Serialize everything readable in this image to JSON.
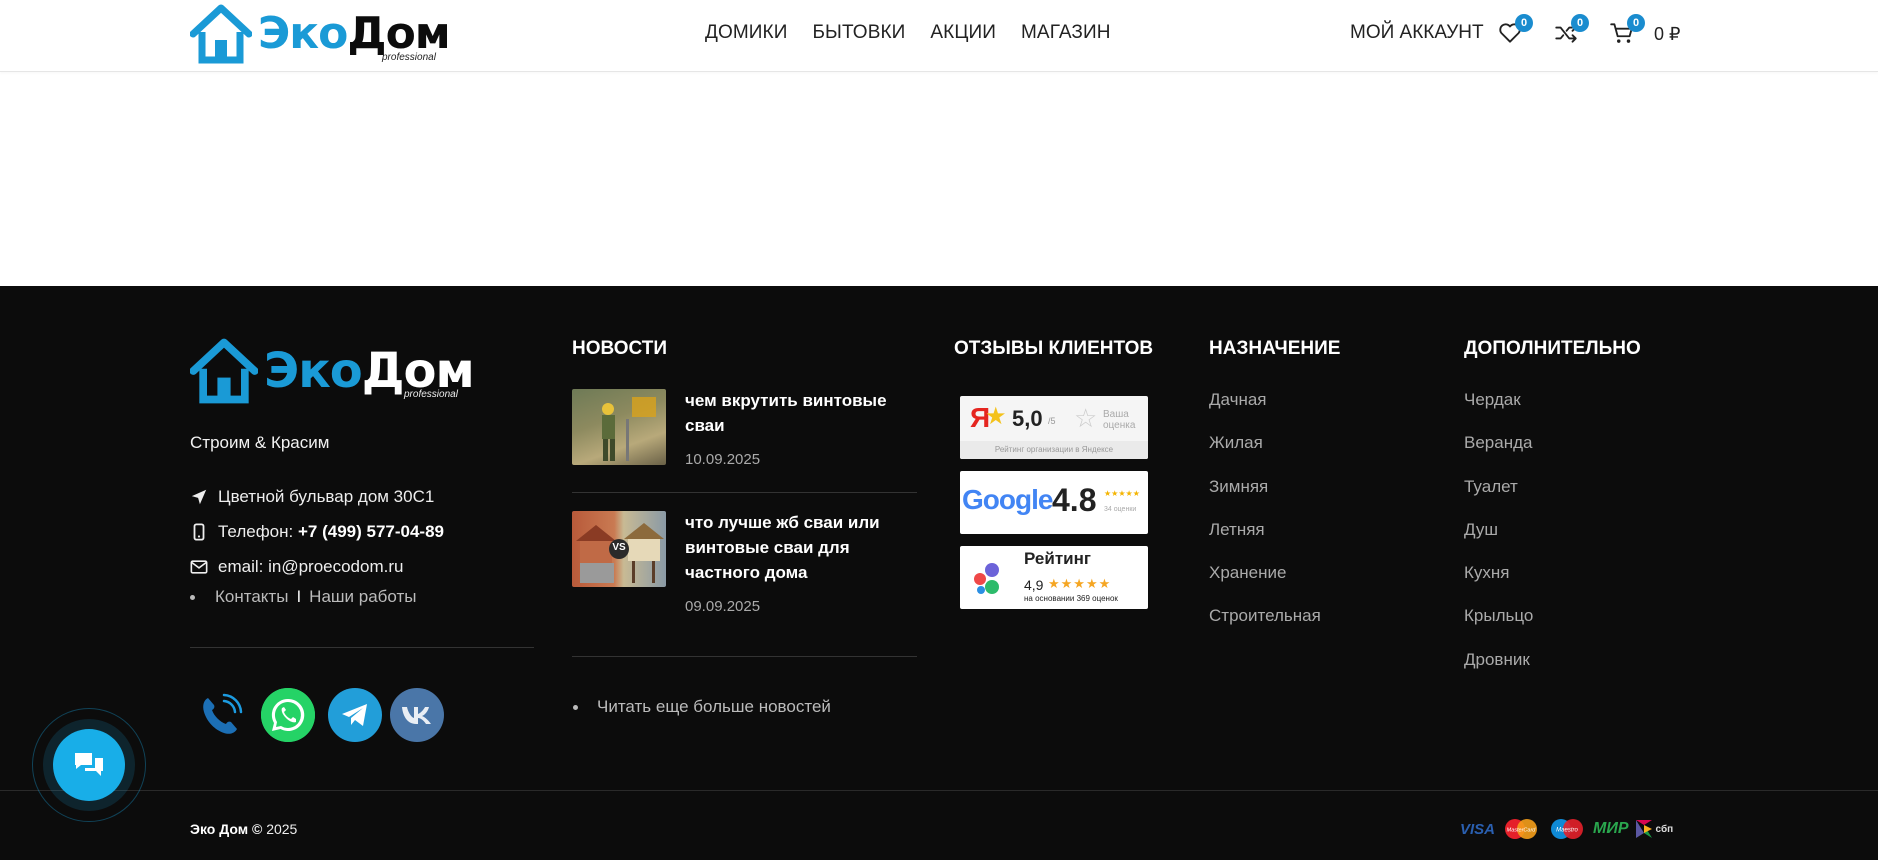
{
  "header": {
    "logo": {
      "part1": "Эко",
      "part2": "Дом",
      "sub": "professional"
    },
    "nav": [
      "ДОМИКИ",
      "БЫТОВКИ",
      "АКЦИИ",
      "МАГАЗИН"
    ],
    "account_label": "МОЙ АККАУНТ",
    "wishlist_count": "0",
    "compare_count": "0",
    "cart_count": "0",
    "cart_total": "0 ₽"
  },
  "footer": {
    "logo": {
      "part1": "Эко",
      "part2": "Дом",
      "sub": "professional"
    },
    "slogan": "Строим & Красим",
    "address": "Цветной бульвар дом 30С1",
    "phone_label": "Телефон:",
    "phone": "+7 (499) 577-04-89",
    "email_label": "email:",
    "email": "in@proecodom.ru",
    "link_contacts": "Контакты",
    "link_separator": "I",
    "link_works": "Наши работы",
    "news": {
      "title": "НОВОСТИ",
      "items": [
        {
          "title": "чем вкрутить винтовые сваи",
          "date": "10.09.2025"
        },
        {
          "title": "что лучше жб сваи или винтовые сваи для частного дома",
          "date": "09.09.2025",
          "thumb_badge": "VS"
        }
      ],
      "more": "Читать еще больше новостей"
    },
    "reviews": {
      "title": "ОТЗЫВЫ КЛИЕНТОВ",
      "yandex": {
        "letter": "Я",
        "score": "5,0",
        "of": "/5",
        "your": "Ваша",
        "rating": "оценка",
        "caption": "Рейтинг организации в Яндексе"
      },
      "google": {
        "brand": "Google",
        "score": "4.8",
        "stars": "★★★★★",
        "caption": "34 оценки"
      },
      "twogis": {
        "title": "Рейтинг",
        "score": "4,9",
        "stars": "★★★★★",
        "caption": "на основании 369 оценок"
      }
    },
    "purpose": {
      "title": "НАЗНАЧЕНИЕ",
      "items": [
        "Дачная",
        "Жилая",
        "Зимняя",
        "Летняя",
        "Хранение",
        "Строительная"
      ]
    },
    "extra": {
      "title": "ДОПОЛНИТЕЛЬНО",
      "items": [
        "Чердак",
        "Веранда",
        "Туалет",
        "Душ",
        "Кухня",
        "Крыльцо",
        "Дровник"
      ]
    },
    "copyright_brand": "Эко Дом",
    "copyright_year": "2025",
    "payments": {
      "visa": "VISA",
      "mastercard": "MasterCard",
      "maestro": "Maestro",
      "mir": "МИР",
      "sbp": "сбп"
    }
  },
  "colors": {
    "accent": "#1a9ad6",
    "footer_bg": "#0c0c0c",
    "badge": "#1a8ccf",
    "chat": "#18aee8"
  }
}
